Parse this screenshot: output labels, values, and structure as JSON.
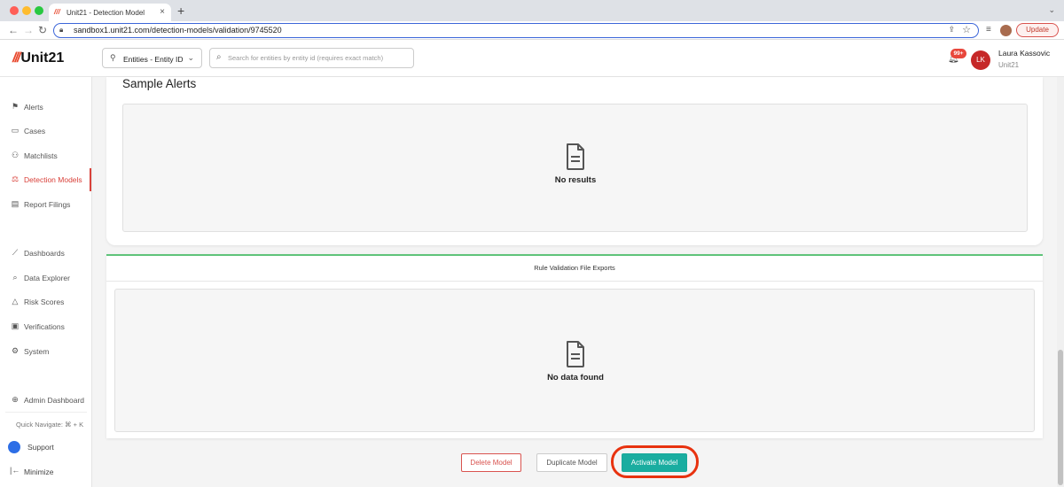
{
  "browser": {
    "tab_title": "Unit21 - Detection Model",
    "tab_favicon": "///",
    "url": "sandbox1.unit21.com/detection-models/validation/9745520",
    "update_label": "Update"
  },
  "header": {
    "logo_mark": "///",
    "logo_text": "Unit21",
    "entity_dropdown_label": "Entities - Entity ID",
    "search_placeholder": "Search for entities by entity id (requires exact match)",
    "notification_count": "99+",
    "user_initials": "LK",
    "user_name": "Laura Kassovic",
    "user_org": "Unit21"
  },
  "sidebar": {
    "items": [
      {
        "label": "Alerts",
        "icon": "flag-icon",
        "glyph": "⚑"
      },
      {
        "label": "Cases",
        "icon": "briefcase-icon",
        "glyph": "▭"
      },
      {
        "label": "Matchlists",
        "icon": "user-plus-icon",
        "glyph": "⚇"
      },
      {
        "label": "Detection Models",
        "icon": "scale-icon",
        "glyph": "⚖"
      },
      {
        "label": "Report Filings",
        "icon": "report-icon",
        "glyph": "▤"
      },
      {
        "label": "Dashboards",
        "icon": "chart-icon",
        "glyph": "⟋"
      },
      {
        "label": "Data Explorer",
        "icon": "data-explorer-icon",
        "glyph": "⌕"
      },
      {
        "label": "Risk Scores",
        "icon": "warning-icon",
        "glyph": "△"
      },
      {
        "label": "Verifications",
        "icon": "id-card-icon",
        "glyph": "▣"
      },
      {
        "label": "System",
        "icon": "gear-icon",
        "glyph": "⚙"
      },
      {
        "label": "Admin Dashboard",
        "icon": "globe-icon",
        "glyph": "⊕"
      }
    ],
    "active_index": 3,
    "quick_navigate": "Quick Navigate: ⌘ + K",
    "support_label": "Support",
    "minimize_label": "Minimize"
  },
  "sample_alerts": {
    "title": "Sample Alerts",
    "empty_text": "No results"
  },
  "exports": {
    "title": "Rule Validation File Exports",
    "empty_text": "No data found"
  },
  "actions": {
    "delete_label": "Delete Model",
    "duplicate_label": "Duplicate Model",
    "activate_label": "Activate Model"
  },
  "colors": {
    "accent": "#d9413a",
    "activate": "#1aada0",
    "highlight": "#e8320f",
    "export_border": "#5fc37a"
  }
}
